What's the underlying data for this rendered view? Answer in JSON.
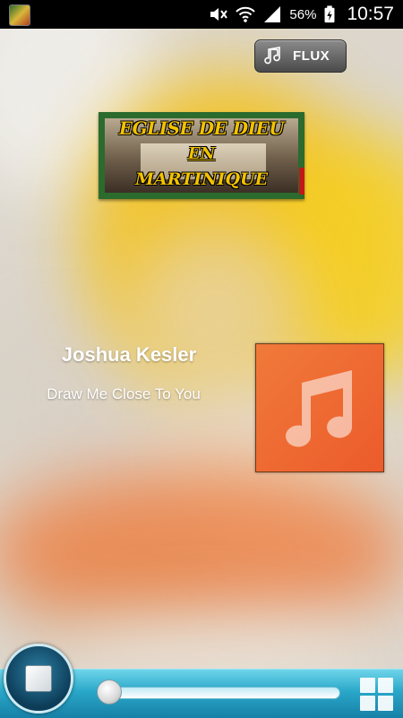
{
  "status_bar": {
    "battery_percent": "56%",
    "time": "10:57",
    "icons": [
      "app-thumbnail-icon",
      "mute-icon",
      "wifi-icon",
      "signal-icon",
      "battery-charging-icon"
    ]
  },
  "header": {
    "flux_label": "FLUX",
    "flux_icon": "music-note-icon"
  },
  "logo": {
    "line1": "EGLISE DE DIEU",
    "line2": "EN",
    "line3": "MARTINIQUE"
  },
  "now_playing": {
    "artist": "Joshua Kesler",
    "title": "Draw Me Close To You",
    "art_icon": "music-note-icon",
    "art_color": "#ef6a35"
  },
  "player": {
    "progress": 0,
    "play_icon": "stop-icon",
    "menu_icon": "grid-icon",
    "accent": "#29a7c9"
  }
}
